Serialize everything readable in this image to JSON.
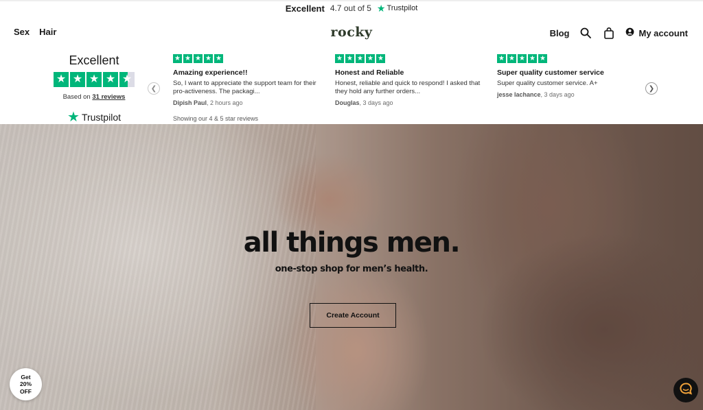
{
  "trustbar": {
    "rating_word": "Excellent",
    "score_text": "4.7 out of 5",
    "brand": "Trustpilot"
  },
  "nav": {
    "left_items": [
      "Sex",
      "Hair"
    ],
    "logo": "rocky",
    "blog": "Blog",
    "account": "My account"
  },
  "reviews_widget": {
    "summary_title": "Excellent",
    "based_prefix": "Based on",
    "based_count": "31 reviews",
    "brand": "Trustpilot",
    "showing": "Showing our 4 & 5 star reviews",
    "star_rating": 4.5,
    "items": [
      {
        "title": "Amazing experience!!",
        "text": "So, I want to appreciate the support team for their pro-activeness. The packagi...",
        "author": "Dipish Paul",
        "time": ", 2 hours ago",
        "stars": 5
      },
      {
        "title": "Honest and Reliable",
        "text": "Honest, reliable and quick to respond! I asked that they hold any further orders...",
        "author": "Douglas",
        "time": ", 3 days ago",
        "stars": 5
      },
      {
        "title": "Super quality customer service",
        "text": "Super quality customer service. A+",
        "author": "jesse lachance",
        "time": ", 3 days ago",
        "stars": 5
      }
    ]
  },
  "hero": {
    "title": "all things men.",
    "subtitle": "one-stop shop for men’s health.",
    "cta": "Create Account"
  },
  "discount_badge": {
    "line1": "Get",
    "line2": "20%",
    "line3": "OFF"
  },
  "colors": {
    "trustpilot_green": "#00b67a",
    "text": "#191919",
    "logo": "#2e3a2a"
  }
}
